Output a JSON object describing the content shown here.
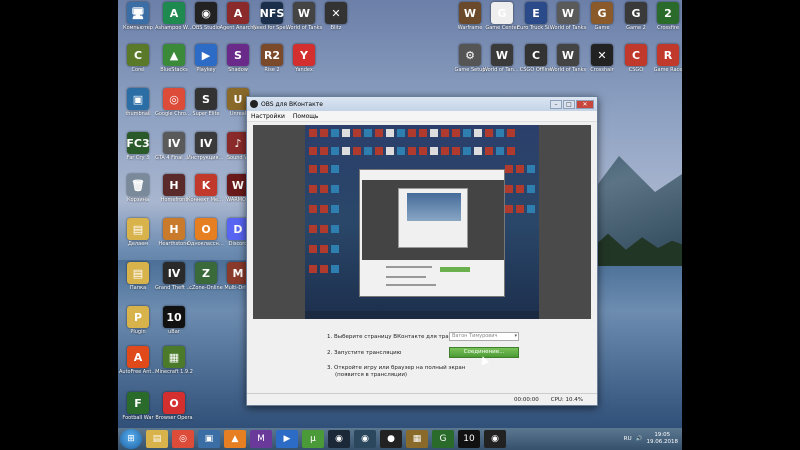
{
  "desktop": {
    "icons": [
      {
        "label": "Компьютер",
        "glyph": "🖥",
        "color": "#3b6ea5"
      },
      {
        "label": "Ashampoo WinOptimizer",
        "glyph": "A",
        "color": "#1e8a4f"
      },
      {
        "label": "OBS Studio",
        "glyph": "◉",
        "color": "#222222"
      },
      {
        "label": "Agent Anarchy",
        "glyph": "A",
        "color": "#8a2a2a"
      },
      {
        "label": "Need for Speed",
        "glyph": "NFS",
        "color": "#1b2e4a"
      },
      {
        "label": "World of Tanks",
        "glyph": "W",
        "color": "#444444"
      },
      {
        "label": "Blitz",
        "glyph": "✕",
        "color": "#333333"
      },
      {
        "label": "Corel",
        "glyph": "C",
        "color": "#5a7a2a"
      },
      {
        "label": "BlueStacks",
        "glyph": "▲",
        "color": "#3a8a3a"
      },
      {
        "label": "Playkey",
        "glyph": "▶",
        "color": "#2c6cc7"
      },
      {
        "label": "Shadow",
        "glyph": "S",
        "color": "#6a2a8a"
      },
      {
        "label": "Rise 2",
        "glyph": "R2",
        "color": "#7a4a2a"
      },
      {
        "label": "Yandex",
        "glyph": "Y",
        "color": "#d32f2f"
      },
      {
        "label": "thumbnail",
        "glyph": "▣",
        "color": "#2a6ea5"
      },
      {
        "label": "Google Chrome",
        "glyph": "◎",
        "color": "#dd4b39"
      },
      {
        "label": "Super Elite",
        "glyph": "S",
        "color": "#333333"
      },
      {
        "label": "Unreal",
        "glyph": "U",
        "color": "#8a6a2a"
      },
      {
        "label": "Far Cry 3",
        "glyph": "FC3",
        "color": "#2a5a2a"
      },
      {
        "label": "GTA 4 Final mod",
        "glyph": "IV",
        "color": "#5a5a5a"
      },
      {
        "label": "Инструкция GTA 4 Final",
        "glyph": "IV",
        "color": "#3a3a3a"
      },
      {
        "label": "Sound W",
        "glyph": "♪",
        "color": "#8a2a2a"
      },
      {
        "label": "Корзина",
        "glyph": "🗑",
        "color": "#7a8a9a"
      },
      {
        "label": "Homefront",
        "glyph": "H",
        "color": "#5a2a2a"
      },
      {
        "label": "Коннект Менеджер",
        "glyph": "K",
        "color": "#c0392b"
      },
      {
        "label": "WARMOD",
        "glyph": "W",
        "color": "#6a1a1a"
      },
      {
        "label": "Делаем",
        "glyph": "▤",
        "color": "#d8b24a"
      },
      {
        "label": "Hearthstone",
        "glyph": "H",
        "color": "#c97a2a"
      },
      {
        "label": "Одноклассники",
        "glyph": "О",
        "color": "#e67e22"
      },
      {
        "label": "Discord",
        "glyph": "D",
        "color": "#5865f2"
      },
      {
        "label": "Папка",
        "glyph": "▤",
        "color": "#d8b24a"
      },
      {
        "label": "Grand Theft Auto IV",
        "glyph": "IV",
        "color": "#2a2a2a"
      },
      {
        "label": "cZone-Online",
        "glyph": "Z",
        "color": "#3a6a3a"
      },
      {
        "label": "Multi-Drive",
        "glyph": "M",
        "color": "#8a3a2a"
      },
      {
        "label": "Plugin",
        "glyph": "P",
        "color": "#d8b24a"
      },
      {
        "label": "uBar",
        "glyph": "10",
        "color": "#111111"
      },
      {
        "label": "AutoFree Antivirus",
        "glyph": "A",
        "color": "#e04a1a"
      },
      {
        "label": "Minecraft 1.9.2",
        "glyph": "▦",
        "color": "#4a7a2a"
      },
      {
        "label": "Browser Opera",
        "glyph": "O",
        "color": "#d32f2f"
      },
      {
        "label": "Football War",
        "glyph": "F",
        "color": "#2a6a2a"
      },
      {
        "label": "OBS для ВКонтакте",
        "glyph": "◉",
        "color": "#222222"
      },
      {
        "label": "Warframe",
        "glyph": "W",
        "color": "#6a4a2a"
      },
      {
        "label": "Game Center",
        "glyph": "G",
        "color": "#eeeeee"
      },
      {
        "label": "Euro Truck Simulator",
        "glyph": "E",
        "color": "#2a4a8a"
      },
      {
        "label": "World of Tanks",
        "glyph": "W",
        "color": "#5a5a5a"
      },
      {
        "label": "Game",
        "glyph": "G",
        "color": "#8a5a2a"
      },
      {
        "label": "Game 2",
        "glyph": "G",
        "color": "#3a3a3a"
      },
      {
        "label": "Crossfire",
        "glyph": "2",
        "color": "#2a6a2a"
      },
      {
        "label": "World of Tanks Blitz",
        "glyph": "W",
        "color": "#3a3a3a"
      },
      {
        "label": "CSGO Offline",
        "glyph": "C",
        "color": "#333333"
      },
      {
        "label": "World of Tanks",
        "glyph": "W",
        "color": "#444444"
      },
      {
        "label": "Crosshair",
        "glyph": "✕",
        "color": "#222222"
      },
      {
        "label": "CSGO",
        "glyph": "C",
        "color": "#c0392b"
      },
      {
        "label": "Game Race",
        "glyph": "R",
        "color": "#c0392b"
      },
      {
        "label": "Game Setup",
        "glyph": "⚙",
        "color": "#555555"
      }
    ]
  },
  "window": {
    "title": "OBS для ВКонтакте",
    "minimize": "–",
    "maximize": "□",
    "close": "✕",
    "menu": [
      "Настройки",
      "Помощь"
    ],
    "steps": {
      "step1": "1. Выберите страницу ВКонтакте для трансляции",
      "step1_select": "Вагон Тимурович",
      "step2": "2. Запустите трансляцию",
      "step2_button": "Соединение...",
      "step3_line1": "3. Откройте игру или браузер на полный экран",
      "step3_line2": "(появится в трансляции)"
    },
    "status": {
      "time": "00:00:00",
      "cpu": "CPU: 10.4%"
    }
  },
  "taskbar": {
    "start_glyph": "⊞",
    "apps": [
      {
        "name": "explorer",
        "glyph": "▤",
        "color": "#d8b24a"
      },
      {
        "name": "chrome",
        "glyph": "◎",
        "color": "#dd4b39"
      },
      {
        "name": "media",
        "glyph": "▣",
        "color": "#3a6ea5"
      },
      {
        "name": "vlc",
        "glyph": "▲",
        "color": "#e67e22"
      },
      {
        "name": "vs",
        "glyph": "M",
        "color": "#6a3a9a"
      },
      {
        "name": "play",
        "glyph": "▶",
        "color": "#2c6cc7"
      },
      {
        "name": "torrent",
        "glyph": "μ",
        "color": "#4a9a3a"
      },
      {
        "name": "steam",
        "glyph": "◉",
        "color": "#1b2838"
      },
      {
        "name": "steam2",
        "glyph": "◉",
        "color": "#2a475e"
      },
      {
        "name": "dvd",
        "glyph": "●",
        "color": "#222222"
      },
      {
        "name": "box",
        "glyph": "▦",
        "color": "#8a6a2a"
      },
      {
        "name": "game",
        "glyph": "G",
        "color": "#2a6a2a"
      },
      {
        "name": "ubar",
        "glyph": "10",
        "color": "#111111"
      },
      {
        "name": "obs",
        "glyph": "◉",
        "color": "#222222"
      }
    ],
    "tray": {
      "lang": "RU",
      "time": "19:05",
      "date": "19.06.2018"
    }
  }
}
